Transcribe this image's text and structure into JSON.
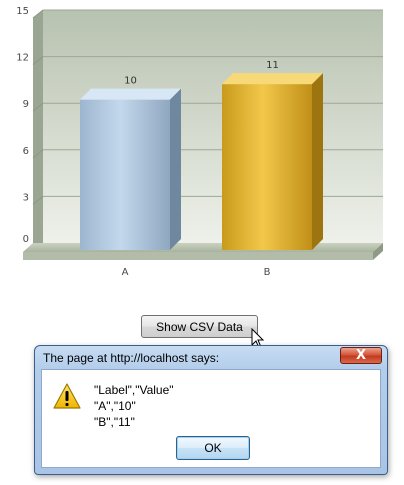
{
  "chart_data": {
    "type": "bar",
    "categories": [
      "A",
      "B"
    ],
    "values": [
      10,
      11
    ],
    "yticks": [
      0,
      3,
      6,
      9,
      12,
      15
    ],
    "ylim": [
      0,
      15
    ],
    "grid": true,
    "bar_colors": [
      "#a9c4e0",
      "#e0b12e"
    ]
  },
  "page": {
    "csv_button_label": "Show CSV Data"
  },
  "dialog": {
    "title": "The page at http://localhost says:",
    "close_label": "X",
    "icon": "warning-icon",
    "message_lines": [
      "\"Label\",\"Value\"",
      "\"A\",\"10\"",
      "\"B\",\"11\""
    ],
    "ok_label": "OK"
  }
}
